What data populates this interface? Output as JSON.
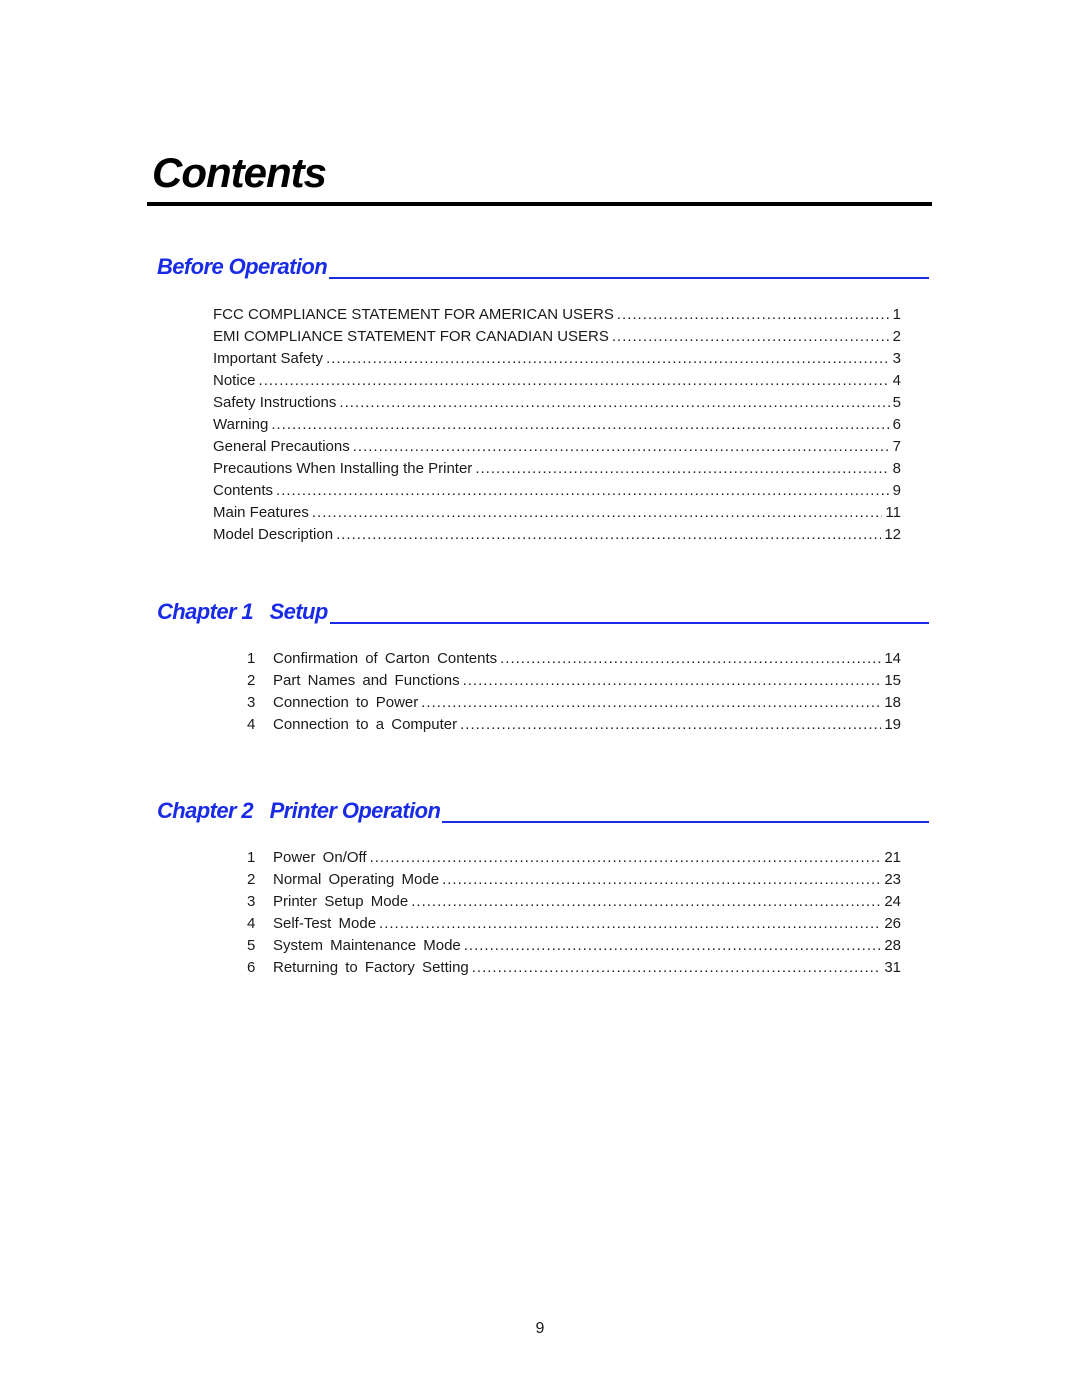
{
  "title": "Contents",
  "sections": [
    {
      "heading": "Before Operation",
      "items": [
        {
          "num": "",
          "text": "FCC COMPLIANCE STATEMENT FOR AMERICAN USERS",
          "page": "1"
        },
        {
          "num": "",
          "text": "EMI COMPLIANCE STATEMENT FOR CANADIAN USERS",
          "page": "2"
        },
        {
          "num": "",
          "text": "Important Safety",
          "page": "3"
        },
        {
          "num": "",
          "text": "Notice",
          "page": "4"
        },
        {
          "num": "",
          "text": "Safety Instructions",
          "page": "5"
        },
        {
          "num": "",
          "text": "Warning",
          "page": "6"
        },
        {
          "num": "",
          "text": "General Precautions",
          "page": "7"
        },
        {
          "num": "",
          "text": "Precautions When Installing the Printer",
          "page": "8"
        },
        {
          "num": "",
          "text": "Contents",
          "page": "9"
        },
        {
          "num": "",
          "text": "Main Features",
          "page": "11"
        },
        {
          "num": "",
          "text": "Model Description",
          "page": "12"
        }
      ]
    },
    {
      "heading": "Chapter 1   Setup",
      "items": [
        {
          "num": "1",
          "text": "Confirmation of Carton Contents",
          "page": "14"
        },
        {
          "num": "2",
          "text": "Part Names and Functions",
          "page": "15"
        },
        {
          "num": "3",
          "text": "Connection to Power",
          "page": "18"
        },
        {
          "num": "4",
          "text": "Connection to a Computer",
          "page": "19"
        }
      ]
    },
    {
      "heading": "Chapter 2   Printer Operation",
      "items": [
        {
          "num": "1",
          "text": "Power On/Off",
          "page": "21"
        },
        {
          "num": "2",
          "text": "Normal Operating Mode",
          "page": "23"
        },
        {
          "num": "3",
          "text": "Printer Setup Mode",
          "page": "24"
        },
        {
          "num": "4",
          "text": "Self-Test Mode",
          "page": "26"
        },
        {
          "num": "5",
          "text": "System Maintenance Mode",
          "page": "28"
        },
        {
          "num": "6",
          "text": "Returning to Factory Setting",
          "page": "31"
        }
      ]
    }
  ],
  "page_number": "9"
}
